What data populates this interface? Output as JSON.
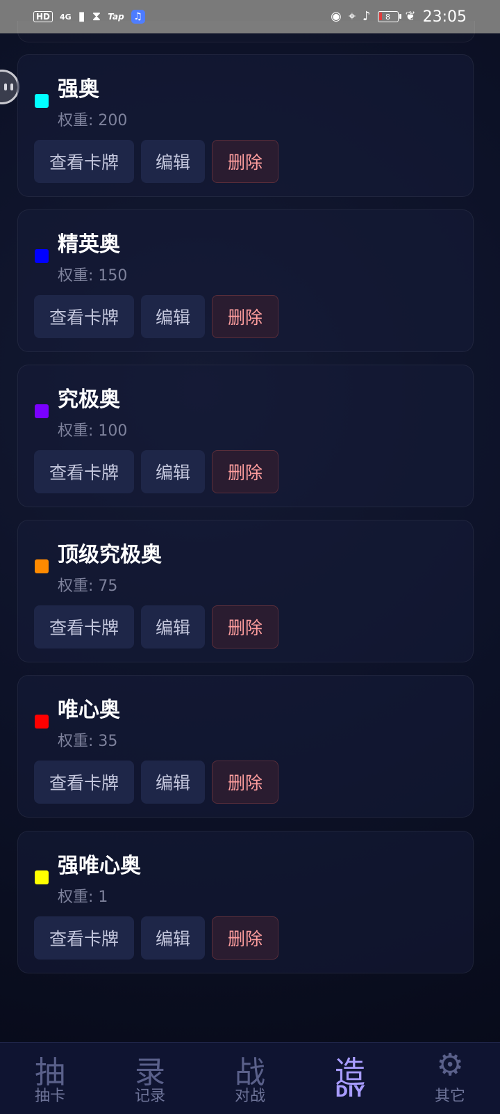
{
  "status_bar": {
    "hd": "HD",
    "network": "4G",
    "tap": "Tap",
    "battery": "8",
    "time": "23:05"
  },
  "cards": [
    {
      "name": "强奥",
      "weight": "权重: 200",
      "color": "#00ffff"
    },
    {
      "name": "精英奥",
      "weight": "权重: 150",
      "color": "#0000ff"
    },
    {
      "name": "究极奥",
      "weight": "权重: 100",
      "color": "#7a00ff"
    },
    {
      "name": "顶级究极奥",
      "weight": "权重: 75",
      "color": "#ff8a00"
    },
    {
      "name": "唯心奥",
      "weight": "权重: 35",
      "color": "#ff0000"
    },
    {
      "name": "强唯心奥",
      "weight": "权重: 1",
      "color": "#ffff00"
    }
  ],
  "buttons": {
    "view": "查看卡牌",
    "edit": "编辑",
    "delete": "删除"
  },
  "nav": [
    {
      "glyph": "抽",
      "label": "抽卡"
    },
    {
      "glyph": "录",
      "label": "记录"
    },
    {
      "glyph": "战",
      "label": "对战"
    },
    {
      "glyph": "造",
      "label": "DIY",
      "active": true
    },
    {
      "glyph": "⚙",
      "label": "其它"
    }
  ],
  "colors": {
    "accent": "#a89cff",
    "delete_text": "#ff9e9e",
    "background": "#0d1228"
  }
}
